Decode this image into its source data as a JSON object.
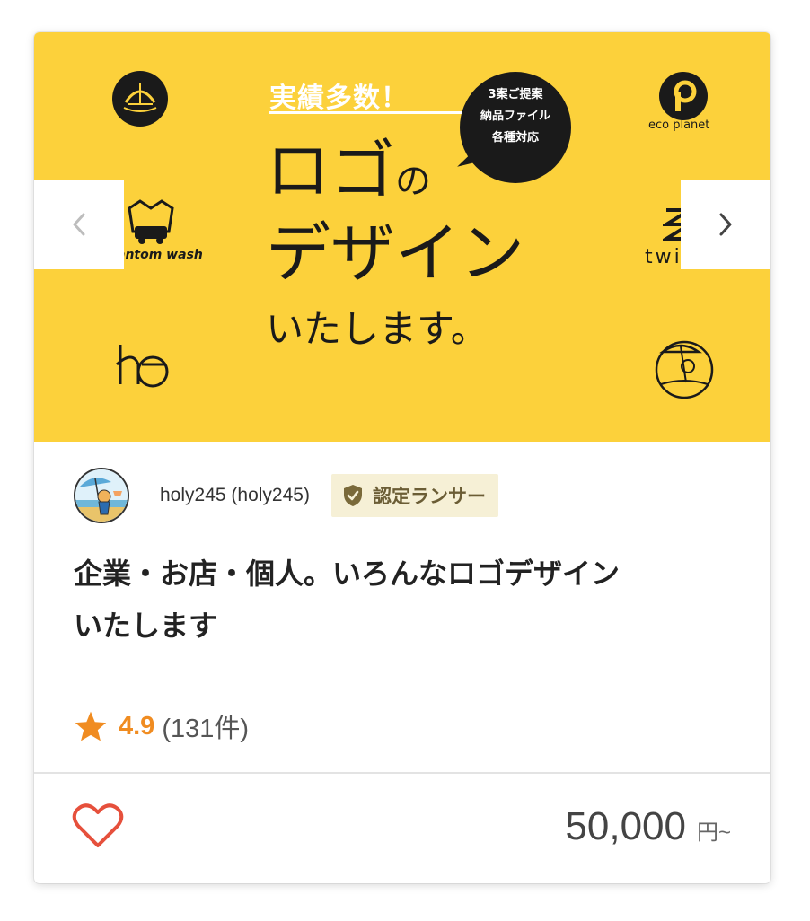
{
  "hero": {
    "tagline": "実績多数！",
    "bubble": [
      "3案ご提案",
      "納品ファイル",
      "各種対応"
    ],
    "headline_main": "ロゴ",
    "headline_particle": "の",
    "headline_2": "デザイン",
    "headline_3": "いたします。",
    "logo_captions": {
      "eco": "eco planet",
      "wash": "antom wash",
      "twist": "twis"
    },
    "bg_color": "#fcd13b"
  },
  "seller": {
    "name": "holy245 (holy245)",
    "badge": "認定ランサー"
  },
  "service": {
    "title_line1": "企業・お店・個人。いろんなロゴデザイン",
    "title_line2": "いたします"
  },
  "rating": {
    "value": "4.9",
    "count": "(131件)",
    "accent": "#f08c21"
  },
  "price": {
    "value": "50,000",
    "unit": "円~"
  },
  "icons": {
    "prev": "chevron-left-icon",
    "next": "chevron-right-icon",
    "favorite": "heart-icon",
    "badge": "shield-check-icon",
    "star": "star-icon"
  }
}
